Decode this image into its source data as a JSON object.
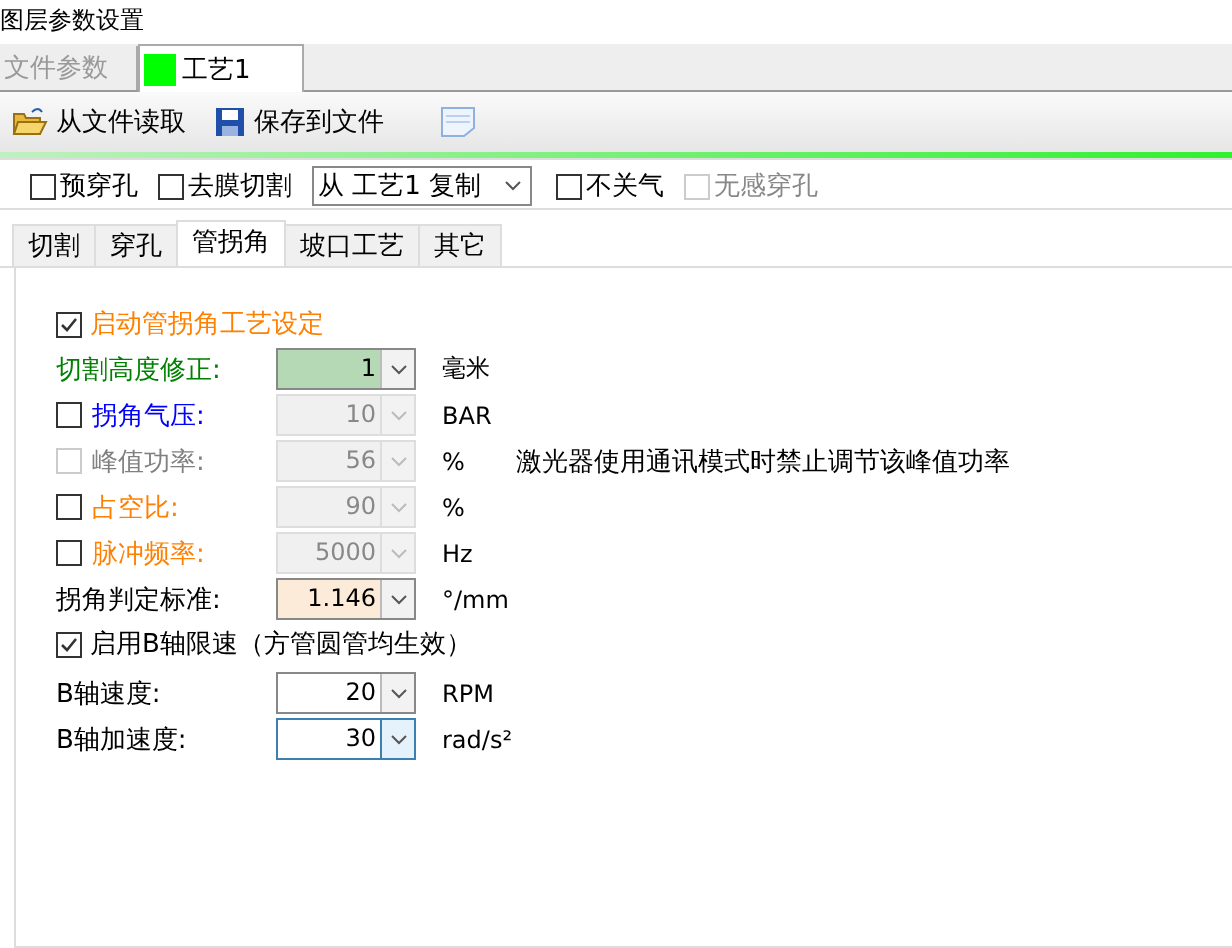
{
  "window": {
    "title": "图层参数设置"
  },
  "doc_tabs": [
    {
      "label": "文件参数",
      "selected": false
    },
    {
      "label": "工艺1",
      "selected": true,
      "color": "#00ff00"
    }
  ],
  "toolbar": [
    {
      "kind": "open",
      "label": "从文件读取"
    },
    {
      "kind": "save",
      "label": "保存到文件"
    },
    {
      "kind": "notes"
    }
  ],
  "options": [
    {
      "kind": "checkbox",
      "label": "预穿孔",
      "checked": false,
      "disabled": false
    },
    {
      "kind": "checkbox",
      "label": "去膜切割",
      "checked": false,
      "disabled": false
    },
    {
      "kind": "dropdown",
      "value": "从 工艺1 复制"
    },
    {
      "kind": "checkbox",
      "label": "不关气",
      "checked": false,
      "disabled": false
    },
    {
      "kind": "checkbox",
      "label": "无感穿孔",
      "checked": false,
      "disabled": true
    }
  ],
  "sub_tabs": [
    {
      "label": "切割",
      "selected": false
    },
    {
      "label": "穿孔",
      "selected": false
    },
    {
      "label": "管拐角",
      "selected": true
    },
    {
      "label": "坡口工艺",
      "selected": false
    },
    {
      "label": "其它",
      "selected": false
    }
  ],
  "enable": {
    "label": "启动管拐角工艺设定",
    "checked": true
  },
  "params": [
    {
      "kind": "plain",
      "label": "切割高度修正:",
      "color": "#008000",
      "field": {
        "value": "1",
        "color": "#b5d8b5",
        "disabled": false,
        "focused": false
      },
      "unit": "毫米"
    },
    {
      "kind": "checkbox",
      "label": "拐角气压:",
      "color": "#0000ff",
      "checked": false,
      "checkbox_disabled": false,
      "field": {
        "value": "10",
        "disabled": true,
        "focused": false
      },
      "unit": "BAR"
    },
    {
      "kind": "checkbox",
      "label": "峰值功率:",
      "color": "#808080",
      "checked": false,
      "checkbox_disabled": true,
      "field": {
        "value": "56",
        "disabled": true,
        "focused": false
      },
      "unit": "%",
      "note": "激光器使用通讯模式时禁止调节该峰值功率"
    },
    {
      "kind": "checkbox",
      "label": "占空比:",
      "color": "#ff8000",
      "checked": false,
      "checkbox_disabled": false,
      "field": {
        "value": "90",
        "disabled": true,
        "focused": false
      },
      "unit": "%"
    },
    {
      "kind": "checkbox",
      "label": "脉冲频率:",
      "color": "#ff8000",
      "checked": false,
      "checkbox_disabled": false,
      "field": {
        "value": "5000",
        "disabled": true,
        "focused": false
      },
      "unit": "Hz"
    },
    {
      "kind": "plain",
      "label": "拐角判定标准:",
      "color": "#000000",
      "field": {
        "value": "1.146",
        "color": "#fdebd9",
        "disabled": false,
        "focused": false
      },
      "unit": "°/mm"
    }
  ],
  "b_axis": {
    "label": "启用B轴限速（方管圆管均生效）",
    "checked": true
  },
  "b_params": [
    {
      "label": "B轴速度:",
      "field": {
        "value": "20",
        "focused": false
      },
      "unit": "RPM"
    },
    {
      "label": "B轴加速度:",
      "field": {
        "value": "30",
        "focused": true
      },
      "unit": "rad/s²"
    }
  ]
}
